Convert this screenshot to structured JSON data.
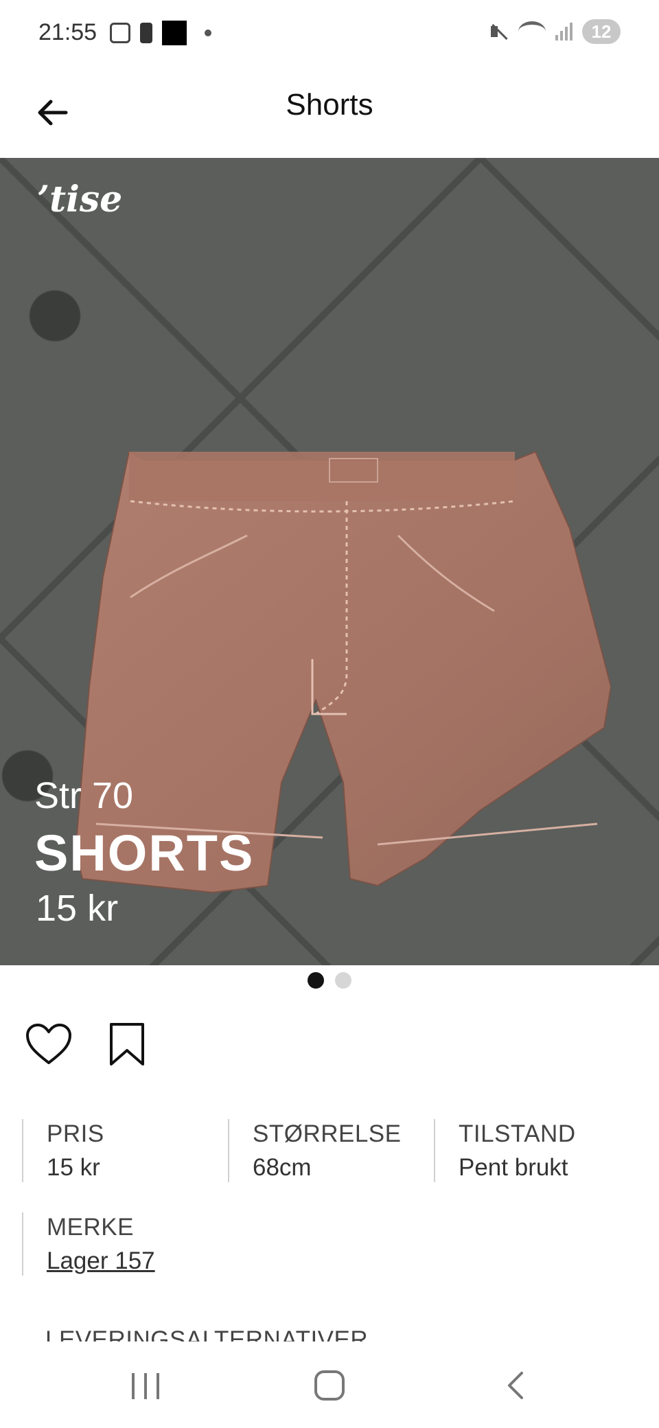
{
  "status_bar": {
    "time": "21:55",
    "notification_count": "12"
  },
  "header": {
    "title": "Shorts"
  },
  "hero": {
    "logo_text": "tise",
    "size_text": "Str 70",
    "title_text": "SHORTS",
    "price_text": "15 kr",
    "pager_total": 2,
    "pager_active_index": 0
  },
  "attributes": {
    "price_label": "PRIS",
    "price_value": "15 kr",
    "size_label": "STØRRELSE",
    "size_value": "68cm",
    "condition_label": "TILSTAND",
    "condition_value": "Pent brukt",
    "brand_label": "MERKE",
    "brand_value": "Lager 157",
    "delivery_label": "LEVERINGSALTERNATIVER"
  },
  "icons": {
    "back": "arrow-left-icon",
    "like": "heart-icon",
    "save": "bookmark-icon"
  },
  "colors": {
    "hero_background": "#5b5e5b",
    "shorts": "#a77566",
    "overlay_text": "#ffffff",
    "pager_active": "#141414",
    "pager_inactive": "#d6d6d6"
  }
}
